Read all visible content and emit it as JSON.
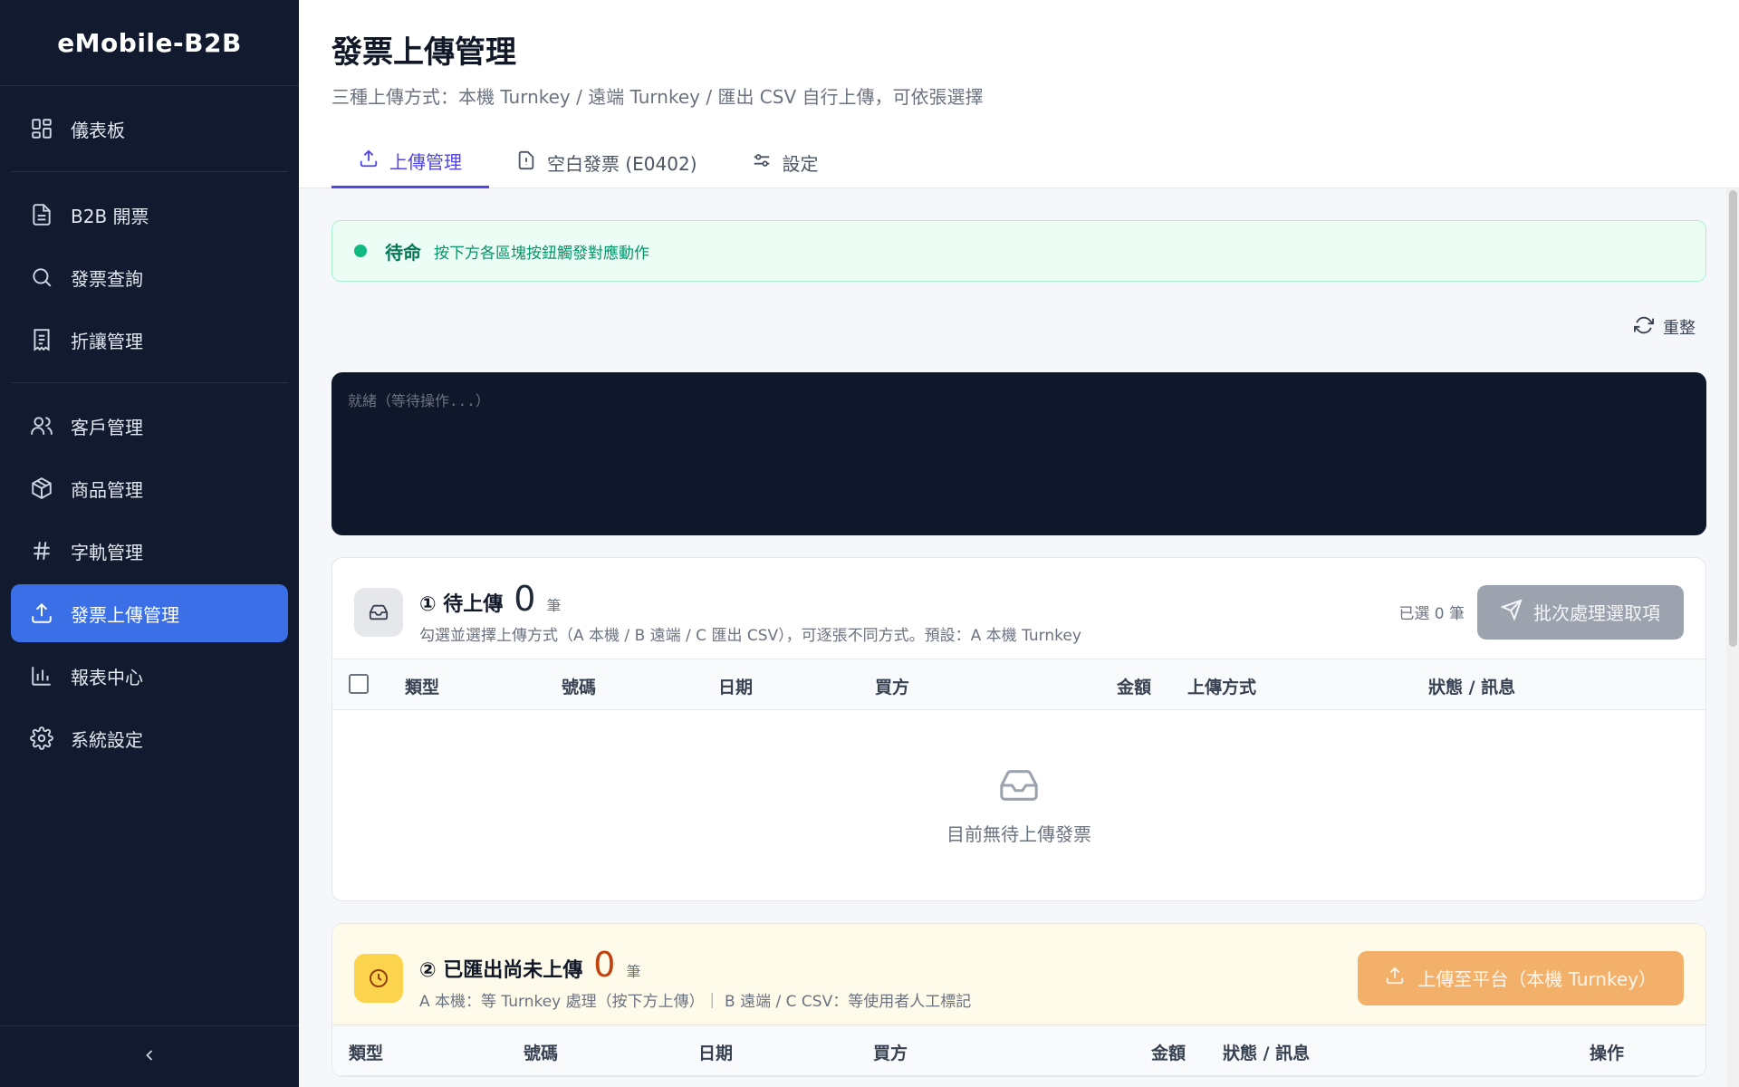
{
  "sidebar": {
    "brand": "eMobile-B2B",
    "items": [
      {
        "label": "儀表板",
        "icon": "dashboard-icon"
      },
      {
        "label": "B2B 開票",
        "icon": "document-icon"
      },
      {
        "label": "發票查詢",
        "icon": "search-icon"
      },
      {
        "label": "折讓管理",
        "icon": "receipt-icon"
      },
      {
        "label": "客戶管理",
        "icon": "users-icon"
      },
      {
        "label": "商品管理",
        "icon": "package-icon"
      },
      {
        "label": "字軌管理",
        "icon": "hash-icon"
      },
      {
        "label": "發票上傳管理",
        "icon": "upload-icon",
        "active": true
      },
      {
        "label": "報表中心",
        "icon": "bar-chart-icon"
      },
      {
        "label": "系統設定",
        "icon": "gear-icon"
      }
    ],
    "collapse_icon": "chevron-left-icon"
  },
  "header": {
    "title": "發票上傳管理",
    "subtitle": "三種上傳方式：本機 Turnkey / 遠端 Turnkey / 匯出 CSV 自行上傳，可依張選擇",
    "tabs": [
      {
        "label": "上傳管理",
        "icon": "upload-icon",
        "active": true
      },
      {
        "label": "空白發票 (E0402)",
        "icon": "file-alert-icon"
      },
      {
        "label": "設定",
        "icon": "sliders-icon"
      }
    ]
  },
  "status": {
    "label": "待命",
    "text": "按下方各區塊按鈕觸發對應動作",
    "color": "#10b981"
  },
  "reset_label": "重整",
  "console_text": "就緒（等待操作...）",
  "pending": {
    "title": "① 待上傳",
    "count": "0",
    "unit": "筆",
    "desc": "勾選並選擇上傳方式（A 本機 / B 遠端 / C 匯出 CSV），可逐張不同方式。預設：A 本機 Turnkey",
    "selected": "已選 0 筆",
    "button": "批次處理選取項",
    "columns": [
      "類型",
      "號碼",
      "日期",
      "買方",
      "金額",
      "上傳方式",
      "狀態 / 訊息"
    ],
    "empty": "目前無待上傳發票"
  },
  "exported": {
    "title": "② 已匯出尚未上傳",
    "count": "0",
    "unit": "筆",
    "desc": "A 本機：等 Turnkey 處理（按下方上傳）｜ B 遠端 / C CSV：等使用者人工標記",
    "button": "上傳至平台（本機 Turnkey）",
    "columns": [
      "類型",
      "號碼",
      "日期",
      "買方",
      "金額",
      "狀態 / 訊息",
      "操作"
    ]
  }
}
